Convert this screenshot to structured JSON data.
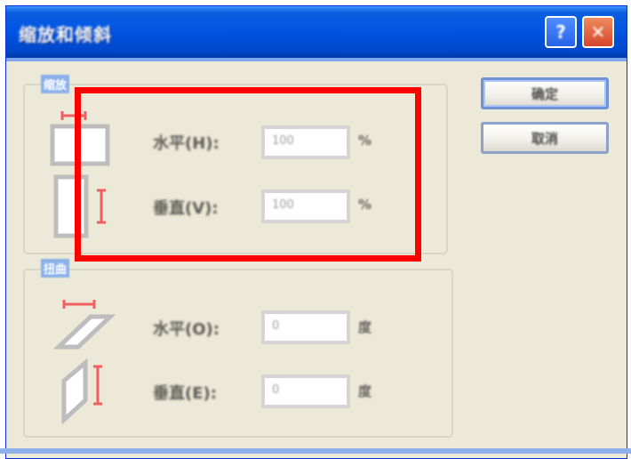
{
  "window": {
    "title": "缩放和倾斜",
    "help_glyph": "?",
    "close_glyph": "✕"
  },
  "scale_group": {
    "label": "缩放",
    "horizontal": {
      "label": "水平(H):",
      "value": "100",
      "unit": "%"
    },
    "vertical": {
      "label": "垂直(V):",
      "value": "100",
      "unit": "%"
    }
  },
  "skew_group": {
    "label": "扭曲",
    "horizontal": {
      "label": "水平(O):",
      "value": "0",
      "unit": "度"
    },
    "vertical": {
      "label": "垂直(E):",
      "value": "0",
      "unit": "度"
    }
  },
  "buttons": {
    "ok": "确定",
    "cancel": "取消"
  },
  "colors": {
    "highlight": "#ff0000",
    "titlebar": "#0054e3",
    "dialog_bg": "#ece9d8"
  }
}
